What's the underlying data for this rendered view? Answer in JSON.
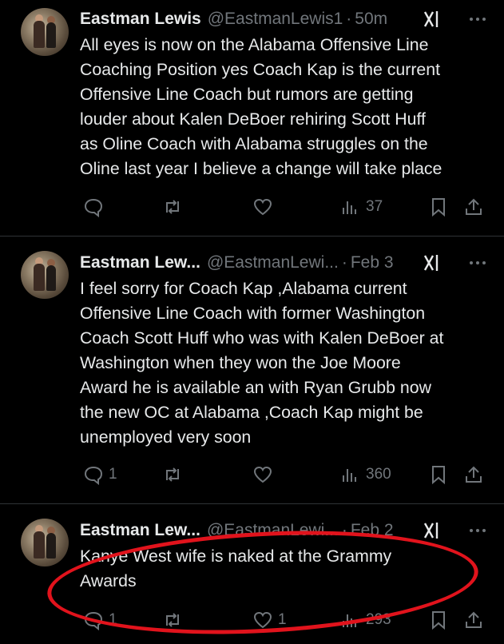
{
  "tweets": [
    {
      "name": "Eastman Lewis",
      "handle": "@EastmanLewis1",
      "time": "50m",
      "text": "All eyes is now on the Alabama Offensive Line\nCoaching Position yes Coach Kap is the current\nOffensive Line Coach but rumors are getting\nlouder about Kalen DeBoer rehiring Scott Huff\nas  Oline Coach with Alabama struggles on the\nOline last year I believe a change will take place",
      "replies": "",
      "reposts": "",
      "likes": "",
      "views": "37"
    },
    {
      "name": "Eastman Lew...",
      "handle": "@EastmanLewi...",
      "time": "Feb 3",
      "text": "I feel sorry for Coach Kap ,Alabama current\nOffensive Line Coach with former Washington\nCoach Scott Huff who was with Kalen DeBoer at\nWashington when they won the Joe Moore\nAward he is available an with Ryan Grubb now\nthe new OC at Alabama ,Coach Kap might be\nunemployed very soon",
      "replies": "1",
      "reposts": "",
      "likes": "",
      "views": "360"
    },
    {
      "name": "Eastman Lew...",
      "handle": "@EastmanLewi...",
      "time": "Feb 2",
      "text": "Kanye West wife is naked at the Grammy\nAwards",
      "replies": "1",
      "reposts": "",
      "likes": "1",
      "views": "293"
    }
  ],
  "separator": "·",
  "icons": {
    "reply": "speech-bubble-icon",
    "repost": "repost-arrows-icon",
    "like": "heart-icon",
    "views": "bar-chart-icon",
    "bookmark": "bookmark-icon",
    "share": "share-upload-icon",
    "grok": "grok-icon",
    "more": "more-dots-icon"
  },
  "colors": {
    "background": "#000000",
    "text": "#e7e9ea",
    "muted": "#71767b",
    "divider": "#2f3336",
    "annotation": "#e1131c"
  }
}
